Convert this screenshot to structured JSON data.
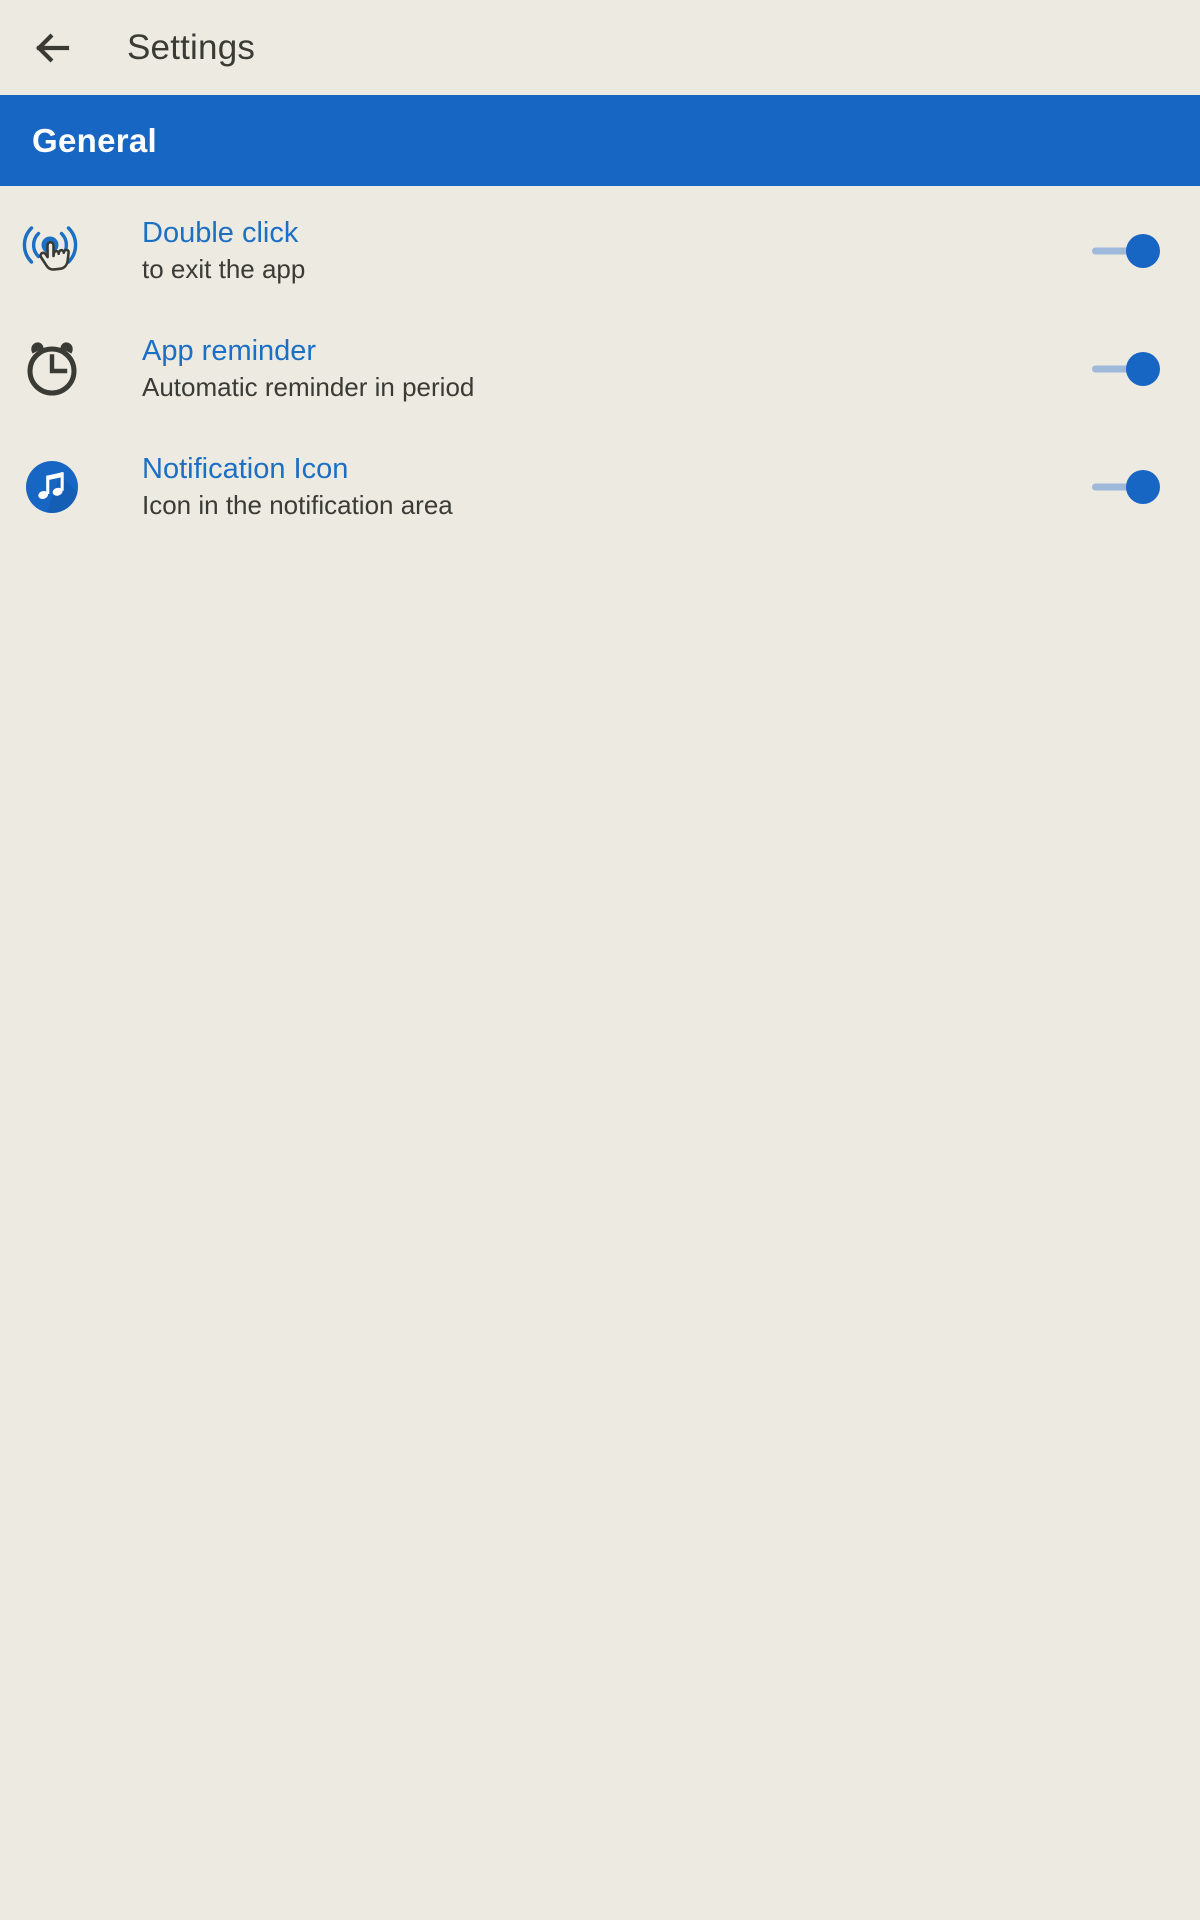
{
  "appbar": {
    "back_icon": "arrow-left-icon",
    "title": "Settings"
  },
  "section": {
    "label": "General",
    "background_color": "#1766C4",
    "text_color": "#FFFFFF"
  },
  "theme": {
    "page_background": "#ECEAE1",
    "accent_blue": "#1766C4",
    "title_blue": "#1B6FC4",
    "body_text": "#3B3B36",
    "toggle_track": "#9FB9DA",
    "toggle_thumb": "#1766C4"
  },
  "settings": [
    {
      "icon": "double-click-ripple-icon",
      "title": "Double click",
      "subtitle": "to exit the app",
      "toggle_state": "on"
    },
    {
      "icon": "alarm-clock-icon",
      "title": "App reminder",
      "subtitle": "Automatic reminder in period",
      "toggle_state": "on"
    },
    {
      "icon": "music-note-notification-icon",
      "title": "Notification Icon",
      "subtitle": "Icon in the notification area",
      "toggle_state": "on"
    }
  ]
}
